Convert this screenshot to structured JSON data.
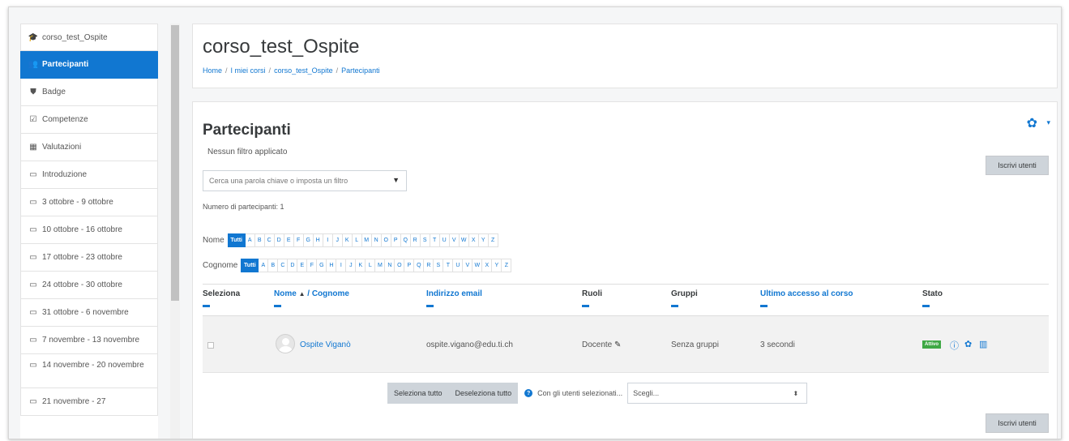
{
  "sidebar": {
    "items": [
      {
        "icon": "graduation-cap-icon",
        "glyph": "🎓",
        "label": "corso_test_Ospite"
      },
      {
        "icon": "users-icon",
        "glyph": "👥",
        "label": "Partecipanti"
      },
      {
        "icon": "shield-icon",
        "glyph": "⛊",
        "label": "Badge"
      },
      {
        "icon": "checkbox-icon",
        "glyph": "☑",
        "label": "Competenze"
      },
      {
        "icon": "table-icon",
        "glyph": "▦",
        "label": "Valutazioni"
      },
      {
        "icon": "folder-icon",
        "glyph": "▭",
        "label": "Introduzione"
      },
      {
        "icon": "folder-icon",
        "glyph": "▭",
        "label": "3 ottobre - 9 ottobre"
      },
      {
        "icon": "folder-icon",
        "glyph": "▭",
        "label": "10 ottobre - 16 ottobre"
      },
      {
        "icon": "folder-icon",
        "glyph": "▭",
        "label": "17 ottobre - 23 ottobre"
      },
      {
        "icon": "folder-icon",
        "glyph": "▭",
        "label": "24 ottobre - 30 ottobre"
      },
      {
        "icon": "folder-icon",
        "glyph": "▭",
        "label": "31 ottobre - 6 novembre"
      },
      {
        "icon": "folder-icon",
        "glyph": "▭",
        "label": "7 novembre - 13 novembre"
      },
      {
        "icon": "folder-icon",
        "glyph": "▭",
        "label": "14 novembre - 20 novembre"
      },
      {
        "icon": "folder-icon",
        "glyph": "▭",
        "label": "21 novembre - 27"
      }
    ]
  },
  "header": {
    "title": "corso_test_Ospite",
    "breadcrumb": [
      "Home",
      "I miei corsi",
      "corso_test_Ospite",
      "Partecipanti"
    ]
  },
  "main": {
    "title": "Partecipanti",
    "filter_status": "Nessun filtro applicato",
    "enrol_button": "Iscrivi utenti",
    "search_placeholder": "Cerca una parola chiave o imposta un filtro",
    "participant_count": "Numero di partecipanti: 1",
    "firstname_label": "Nome",
    "lastname_label": "Cognome",
    "all_label": "Tutti",
    "letters": [
      "A",
      "B",
      "C",
      "D",
      "E",
      "F",
      "G",
      "H",
      "I",
      "J",
      "K",
      "L",
      "M",
      "N",
      "O",
      "P",
      "Q",
      "R",
      "S",
      "T",
      "U",
      "V",
      "W",
      "X",
      "Y",
      "Z"
    ]
  },
  "table": {
    "headers": {
      "select": "Seleziona",
      "name": "Nome",
      "name_sort": "▲",
      "surname": "/ Cognome",
      "email": "Indirizzo email",
      "roles": "Ruoli",
      "groups": "Gruppi",
      "last_access": "Ultimo accesso al corso",
      "status": "Stato"
    },
    "rows": [
      {
        "name": "Ospite Viganò",
        "email": "ospite.vigano@edu.ti.ch",
        "role": "Docente",
        "groups": "Senza gruppi",
        "last_access": "3 secondi",
        "status": "Attivo"
      }
    ]
  },
  "bulk": {
    "select_all": "Seleziona tutto",
    "deselect_all": "Deseleziona tutto",
    "with_selected": "Con gli utenti selezionati...",
    "choose": "Scegli..."
  },
  "colors": {
    "accent": "#1177d1",
    "active_badge": "#3fa845"
  }
}
